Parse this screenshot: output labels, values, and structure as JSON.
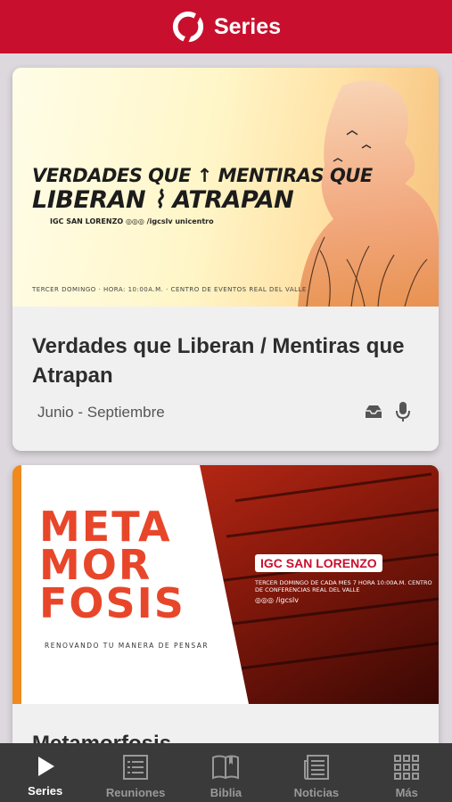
{
  "header": {
    "title": "Series",
    "logo_icon": "church-logo-icon"
  },
  "colors": {
    "brand": "#c8102e",
    "tabbar": "#3a3a3a",
    "background": "#ddd8de"
  },
  "series": [
    {
      "title": "Verdades que Liberan / Mentiras que Atrapan",
      "subtitle": "Junio - Septiembre",
      "icons": [
        "inbox-icon",
        "microphone-icon"
      ],
      "banner": {
        "line1": "VERDADES QUE ↑ MENTIRAS QUE",
        "line2": "LIBERAN ⌇ ATRAPAN",
        "meta": "IGC SAN LORENZO   ◎◎◎ /igcslv   unicentro",
        "footer": "TERCER DOMINGO  ·  HORA: 10:00A.M.  ·  CENTRO DE EVENTOS REAL DEL VALLE"
      }
    },
    {
      "title": "Metamorfosis",
      "banner": {
        "title_lines": [
          "META",
          "MOR",
          "FOSIS"
        ],
        "tagline": "RENOVANDO TU MANERA DE PENSAR",
        "church": "IGC SAN LORENZO",
        "info": "TERCER DOMINGO DE CADA MES 7 HORA 10:00A.M. CENTRO DE CONFERENCIAS REAL DEL VALLE",
        "social": "◎◎◎ /igcslv"
      }
    }
  ],
  "tabs": [
    {
      "label": "Series",
      "icon": "play-icon",
      "active": true
    },
    {
      "label": "Reuniones",
      "icon": "list-icon",
      "active": false
    },
    {
      "label": "Biblia",
      "icon": "book-icon",
      "active": false
    },
    {
      "label": "Noticias",
      "icon": "newspaper-icon",
      "active": false
    },
    {
      "label": "Más",
      "icon": "grid-icon",
      "active": false
    }
  ]
}
